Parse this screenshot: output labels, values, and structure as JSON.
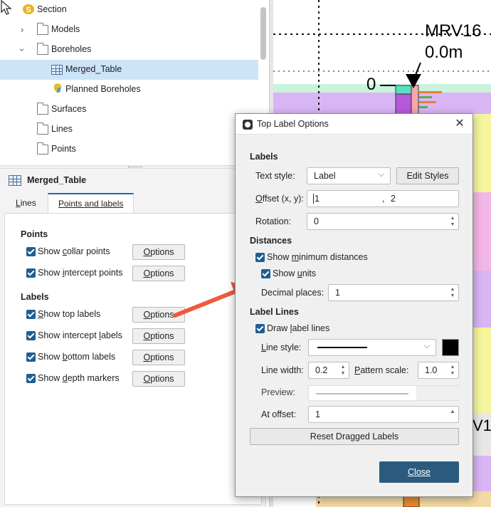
{
  "tree": {
    "items": [
      {
        "label": "Section",
        "icon": "section-icon"
      },
      {
        "label": "Models",
        "icon": "folder-icon"
      },
      {
        "label": "Boreholes",
        "icon": "folder-icon"
      },
      {
        "label": "Merged_Table",
        "icon": "table-icon"
      },
      {
        "label": "Planned Boreholes",
        "icon": "planned-borehole-icon"
      },
      {
        "label": "Surfaces",
        "icon": "folder-icon"
      },
      {
        "label": "Lines",
        "icon": "folder-icon"
      },
      {
        "label": "Points",
        "icon": "folder-icon"
      }
    ],
    "section_badge": "S"
  },
  "properties": {
    "title": "Merged_Table",
    "tabs": [
      {
        "label": "Lines",
        "hotkey": "L",
        "rest": "ines"
      },
      {
        "label": "Points and labels"
      }
    ],
    "points_heading": "Points",
    "labels_heading": "Labels",
    "show_collar_points": {
      "pre": "Show ",
      "key": "c",
      "post": "ollar points"
    },
    "show_intercept_points": {
      "pre": "Show ",
      "key": "i",
      "post": "ntercept points"
    },
    "show_top_labels": {
      "pre": "",
      "key": "S",
      "post": "how top labels"
    },
    "show_intercept_labels": {
      "pre": "Show intercept ",
      "key": "l",
      "post": "abels"
    },
    "show_bottom_labels": {
      "pre": "Show ",
      "key": "b",
      "post": "ottom labels"
    },
    "show_depth_markers": {
      "pre": "Show ",
      "key": "d",
      "post": "epth markers"
    },
    "options_label": "Options",
    "options_key": "O",
    "options_rest": "ptions"
  },
  "scene": {
    "hole_name": "MRV16",
    "hole_depth": "0.0m",
    "depth_label": "0",
    "partial_label": "V1"
  },
  "dialog": {
    "title": "Top Label Options",
    "labels_heading": "Labels",
    "text_style_label": "Text style:",
    "text_style_value": "Label",
    "edit_styles": "Edit Styles",
    "offset_label_key": "O",
    "offset_label_rest": "ffset (x, y):",
    "offset_x": "1",
    "offset_sep": ",",
    "offset_y": "2",
    "rotation_label": "Rotation:",
    "rotation_value": "0",
    "distances_heading": "Distances",
    "show_min_pre": "Show ",
    "show_min_key": "m",
    "show_min_post": "inimum distances",
    "show_units_pre": "Show ",
    "show_units_key": "u",
    "show_units_post": "nits",
    "decimal_places_label": "Decimal places:",
    "decimal_places_value": "1",
    "label_lines_heading": "Label Lines",
    "draw_label_pre": "Draw ",
    "draw_label_key": "l",
    "draw_label_post": "abel lines",
    "line_style_pre": "",
    "line_style_key": "L",
    "line_style_post": "ine style:",
    "line_width_label": "Line width:",
    "line_width_value": "0.2",
    "pattern_scale_pre": "",
    "pattern_scale_key": "P",
    "pattern_scale_post": "attern scale:",
    "pattern_scale_value": "1.0",
    "preview_label": "Preview:",
    "at_offset_label": "At offset:",
    "at_offset_value": "1",
    "reset_button": "Reset Dragged Labels",
    "close_button": "Close",
    "line_color": "#000000"
  },
  "colors": {
    "accent": "#1e6ba8",
    "selection": "#cce4f7",
    "close_button": "#2a5b7f",
    "annotation_arrow": "#ee5a3c"
  }
}
